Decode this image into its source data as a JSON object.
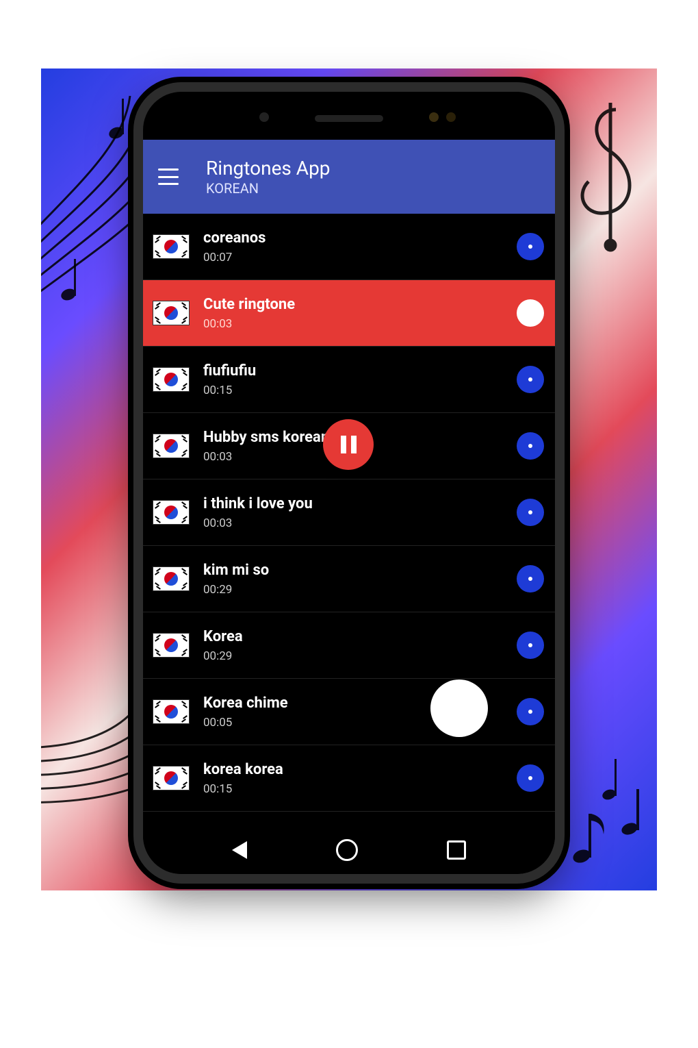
{
  "app": {
    "title": "Ringtones App",
    "subtitle": "KOREAN"
  },
  "colors": {
    "primary": "#3F51B5",
    "accent_play": "#1e3bd6",
    "selected_bg": "#E53935",
    "fab": "#E53935"
  },
  "fab": {
    "state": "pause",
    "icon": "pause-icon"
  },
  "ringtones": [
    {
      "name": "coreanos",
      "duration": "00:07",
      "selected": false,
      "icon": "korea-flag"
    },
    {
      "name": "Cute ringtone",
      "duration": "00:03",
      "selected": true,
      "icon": "korea-flag"
    },
    {
      "name": "fiufiufiu",
      "duration": "00:15",
      "selected": false,
      "icon": "korea-flag"
    },
    {
      "name": "Hubby sms korean",
      "duration": "00:03",
      "selected": false,
      "icon": "korea-flag"
    },
    {
      "name": "i think i love you",
      "duration": "00:03",
      "selected": false,
      "icon": "korea-flag"
    },
    {
      "name": "kim mi so",
      "duration": "00:29",
      "selected": false,
      "icon": "korea-flag"
    },
    {
      "name": "Korea",
      "duration": "00:29",
      "selected": false,
      "icon": "korea-flag"
    },
    {
      "name": "Korea chime",
      "duration": "00:05",
      "selected": false,
      "icon": "korea-flag"
    },
    {
      "name": "korea korea",
      "duration": "00:15",
      "selected": false,
      "icon": "korea-flag"
    }
  ],
  "nav": {
    "back": "back-icon",
    "home": "home-icon",
    "recent": "recent-icon"
  }
}
